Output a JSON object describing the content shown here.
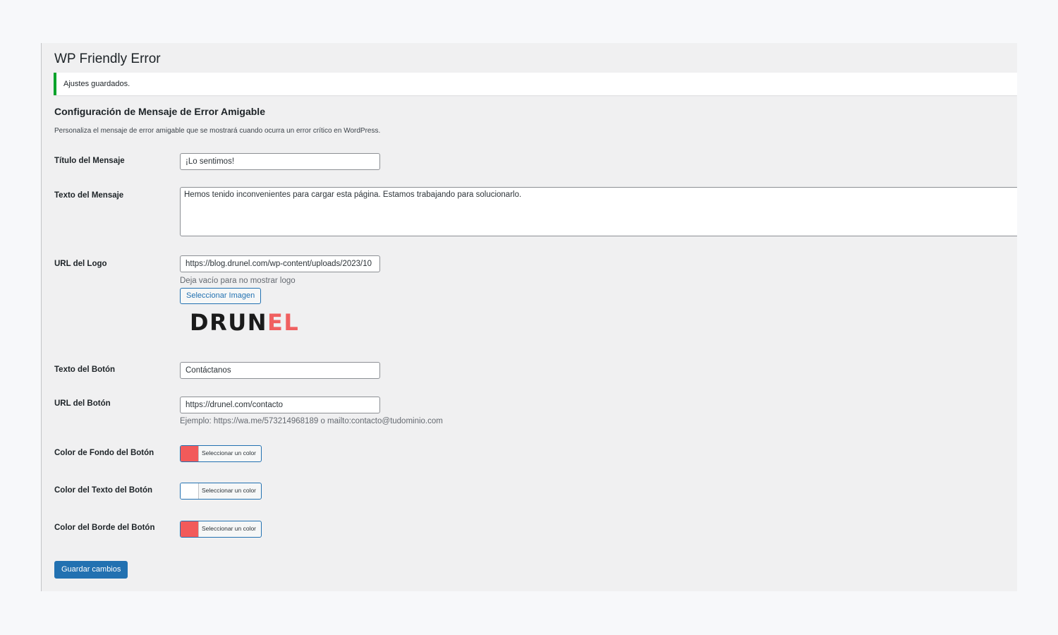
{
  "page": {
    "title": "WP Friendly Error"
  },
  "notice": {
    "text": "Ajustes guardados."
  },
  "section": {
    "title": "Configuración de Mensaje de Error Amigable",
    "description": "Personaliza el mensaje de error amigable que se mostrará cuando ocurra un error crítico en WordPress."
  },
  "fields": {
    "message_title": {
      "label": "Título del Mensaje",
      "value": "¡Lo sentimos!"
    },
    "message_text": {
      "label": "Texto del Mensaje",
      "value": "Hemos tenido inconvenientes para cargar esta página. Estamos trabajando para solucionarlo."
    },
    "logo_url": {
      "label": "URL del Logo",
      "value": "https://blog.drunel.com/wp-content/uploads/2023/10",
      "help": "Deja vacío para no mostrar logo",
      "select_button": "Seleccionar Imagen",
      "logo_preview_dark": "DRUN",
      "logo_preview_red": "EL"
    },
    "button_text": {
      "label": "Texto del Botón",
      "value": "Contáctanos"
    },
    "button_url": {
      "label": "URL del Botón",
      "value": "https://drunel.com/contacto",
      "help": "Ejemplo: https://wa.me/573214968189 o mailto:contacto@tudominio.com"
    },
    "button_bg_color": {
      "label": "Color de Fondo del Botón",
      "picker_label": "Seleccionar un color",
      "color": "#f25a5a"
    },
    "button_text_color": {
      "label": "Color del Texto del Botón",
      "picker_label": "Seleccionar un color",
      "color": "#ffffff"
    },
    "button_border_color": {
      "label": "Color del Borde del Botón",
      "picker_label": "Seleccionar un color",
      "color": "#f25a5a"
    }
  },
  "submit": {
    "label": "Guardar cambios"
  },
  "colors": {
    "accent": "#2271b1",
    "success": "#00a32a",
    "logo_red": "#f06060"
  }
}
